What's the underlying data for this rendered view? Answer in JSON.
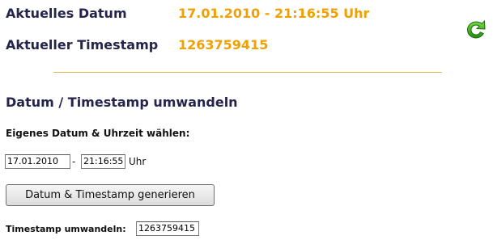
{
  "current": {
    "date_label": "Aktuelles Datum",
    "date_value": "17.01.2010 - 21:16:55 Uhr",
    "timestamp_label": "Aktueller Timestamp",
    "timestamp_value": "1263759415"
  },
  "refresh": {
    "icon": "refresh-arrow-icon",
    "color": "#2f9e1e"
  },
  "section": {
    "title": "Datum / Timestamp umwandeln",
    "custom_label": "Eigenes Datum & Uhrzeit wählen:",
    "date_input_value": "17.01.2010",
    "separator": "-",
    "time_input_value": "21:16:55",
    "time_unit": "Uhr",
    "generate_button": "Datum & Timestamp generieren",
    "convert_label": "Timestamp umwandeln:",
    "convert_input_value": "1263759415"
  },
  "colors": {
    "accent": "#f0a000",
    "heading": "#24244d",
    "divider": "#e0b64a"
  }
}
